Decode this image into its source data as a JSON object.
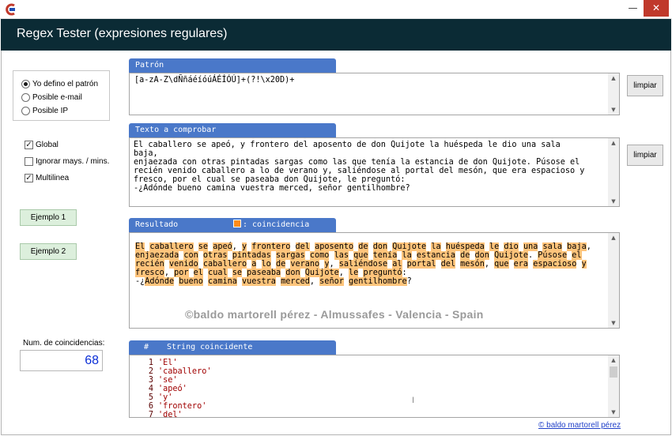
{
  "window": {
    "title": "Regex Tester (expresiones regulares)",
    "minimize": "—",
    "close": "✕"
  },
  "options": {
    "radios": [
      {
        "label": "Yo defino el patrón",
        "checked": true
      },
      {
        "label": "Posible e-mail",
        "checked": false
      },
      {
        "label": "Posible IP",
        "checked": false
      }
    ],
    "checks": [
      {
        "label": "Global",
        "checked": true
      },
      {
        "label": "Ignorar mays. / mins.",
        "checked": false
      },
      {
        "label": "Multilinea",
        "checked": true
      }
    ],
    "example1": "Ejemplo 1",
    "example2": "Ejemplo 2"
  },
  "pattern": {
    "tab": "Patrón",
    "value": "[a-zA-Z\\dÑñáéíóúÁÉÍÓÚ]+(?!\\x20D)+",
    "clear": "limpiar"
  },
  "input": {
    "tab": "Texto a comprobar",
    "value": "El caballero se apeó, y frontero del aposento de don Quijote la huéspeda le dio una sala baja,\nenjaezada con otras pintadas sargas como las que tenía la estancia de don Quijote. Púsose el\nrecién venido caballero a lo de verano y, saliéndose al portal del mesón, que era espacioso y\nfresco, por el cual se paseaba don Quijote, le preguntó:\n-¿Adónde bueno camina vuestra merced, señor gentilhombre?",
    "clear": "limpiar"
  },
  "result": {
    "tab": "Resultado",
    "legend": ": coincidencia",
    "match_color": "#ffc47b",
    "swatch_color": "#ff8c1a",
    "watermark": "©baldo martorell pérez  - Almussafes - Valencia - Spain"
  },
  "count": {
    "label": "Num. de coincidencias:",
    "value": "68"
  },
  "matches": {
    "header_idx": "#",
    "header_col": "String coincidente",
    "items": [
      "'El'",
      "'caballero'",
      "'se'",
      "'apeó'",
      "'y'",
      "'frontero'",
      "'del'"
    ]
  },
  "footer": {
    "link": "© baldo martorell pérez"
  }
}
